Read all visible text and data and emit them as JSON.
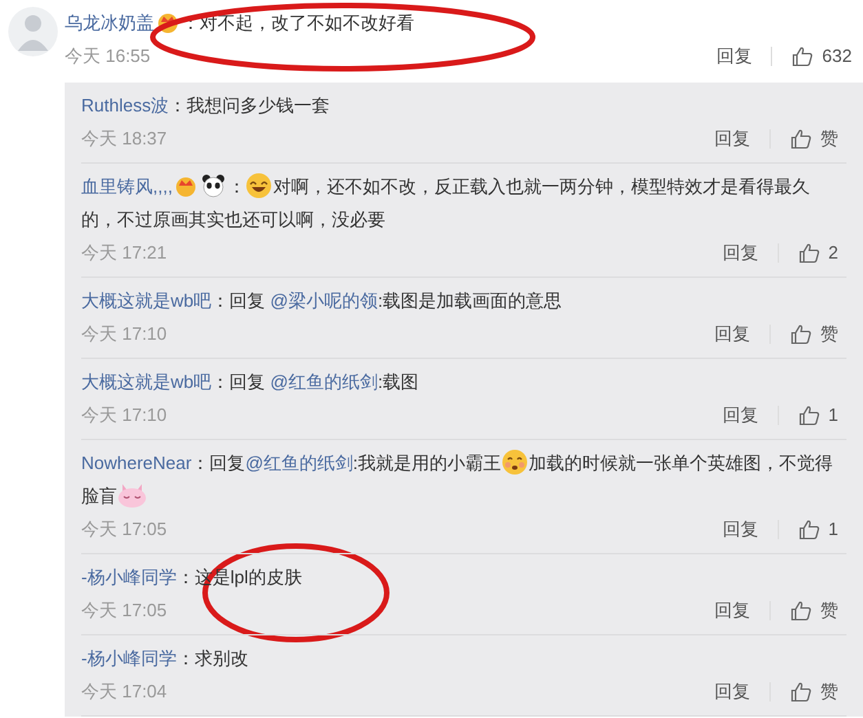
{
  "comment": {
    "user": "乌龙冰奶盖",
    "parts": [
      {
        "kind": "badge"
      },
      {
        "kind": "text",
        "text": "：对不起，改了不如不改好看"
      }
    ],
    "time": "今天 16:55",
    "reply": "回复",
    "likes": "632"
  },
  "replies": [
    {
      "user": "Ruthless波",
      "parts": [
        {
          "kind": "text",
          "text": "：我想问多少钱一套"
        }
      ],
      "time": "今天 18:37",
      "reply": "回复",
      "likes": "赞"
    },
    {
      "user": "血里铸风,,,,",
      "parts": [
        {
          "kind": "badge"
        },
        {
          "kind": "panda"
        },
        {
          "kind": "text",
          "text": "："
        },
        {
          "kind": "laugh"
        },
        {
          "kind": "text",
          "text": "对啊，还不如不改，反正载入也就一两分钟，模型特效才是看得最久的，不过原画其实也还可以啊，没必要"
        }
      ],
      "time": "今天 17:21",
      "reply": "回复",
      "likes": "2"
    },
    {
      "user": "大概这就是wb吧",
      "parts": [
        {
          "kind": "text",
          "text": "：回复 "
        },
        {
          "kind": "mention",
          "text": "@梁小呢的领"
        },
        {
          "kind": "text",
          "text": ":载图是加载画面的意思"
        }
      ],
      "time": "今天 17:10",
      "reply": "回复",
      "likes": "赞"
    },
    {
      "user": "大概这就是wb吧",
      "parts": [
        {
          "kind": "text",
          "text": "：回复 "
        },
        {
          "kind": "mention",
          "text": "@红鱼的纸剑"
        },
        {
          "kind": "text",
          "text": ":载图"
        }
      ],
      "time": "今天 17:10",
      "reply": "回复",
      "likes": "1"
    },
    {
      "user": "NowhereNear",
      "parts": [
        {
          "kind": "text",
          "text": "：回复"
        },
        {
          "kind": "mention",
          "text": "@红鱼的纸剑"
        },
        {
          "kind": "text",
          "text": ":我就是用的小霸王"
        },
        {
          "kind": "shy"
        },
        {
          "kind": "text",
          "text": "加载的时候就一张单个英雄图，不觉得脸盲"
        },
        {
          "kind": "pig"
        }
      ],
      "time": "今天 17:05",
      "reply": "回复",
      "likes": "1"
    },
    {
      "user": "-杨小峰同学",
      "parts": [
        {
          "kind": "text",
          "text": "：这是lpl的皮肤"
        }
      ],
      "time": "今天 17:05",
      "reply": "回复",
      "likes": "赞"
    },
    {
      "user": "-杨小峰同学",
      "parts": [
        {
          "kind": "text",
          "text": "：求别改"
        }
      ],
      "time": "今天 17:04",
      "reply": "回复",
      "likes": "赞"
    }
  ]
}
